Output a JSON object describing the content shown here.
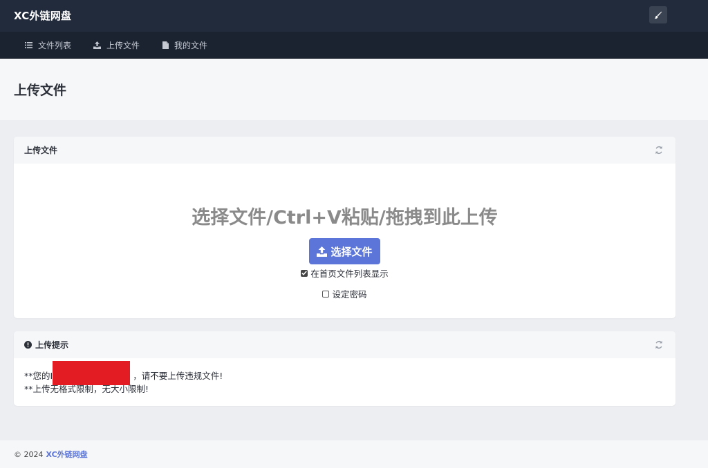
{
  "brand": {
    "name": "XC外链网盘"
  },
  "topbar": {
    "theme_button_icon": "paintbrush-icon"
  },
  "nav": [
    {
      "label": "文件列表",
      "icon": "list-icon"
    },
    {
      "label": "上传文件",
      "icon": "upload-icon"
    },
    {
      "label": "我的文件",
      "icon": "file-icon"
    }
  ],
  "page": {
    "title": "上传文件"
  },
  "upload_card": {
    "title": "上传文件",
    "headline": "选择文件/Ctrl+V粘贴/拖拽到此上传",
    "choose_button": "选择文件",
    "show_in_list_label": "在首页文件列表显示",
    "show_in_list_checked": true,
    "password_label": "设定密码",
    "password_checked": false
  },
  "tip_card": {
    "title": "上传提示",
    "line1_prefix": "**您的I",
    "line1_suffix": "，请不要上传违规文件!",
    "line2": "**上传无格式限制，无大小限制!"
  },
  "footer": {
    "copyright": "© 2024",
    "link": "XC外链网盘"
  },
  "colors": {
    "topbar": "#222b3b",
    "navbar": "#1b2230",
    "accent": "#5b75d9",
    "redact": "#e31b23"
  }
}
